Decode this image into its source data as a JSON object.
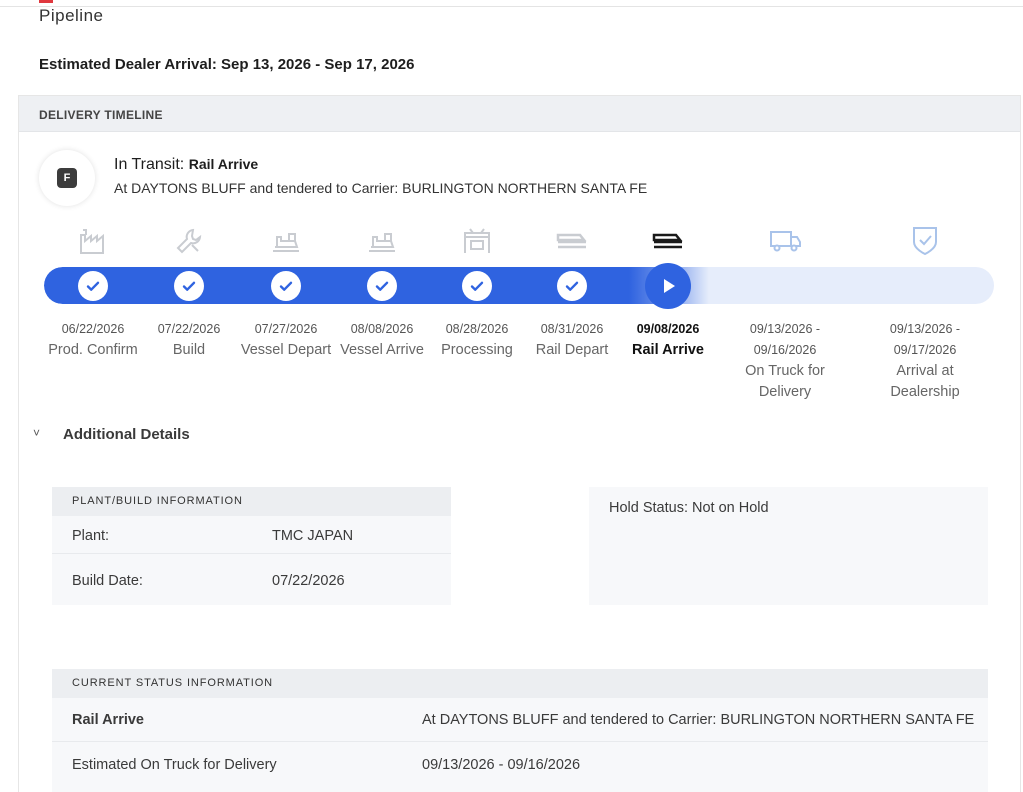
{
  "page": {
    "tab_label": "Pipeline",
    "estimated_arrival": "Estimated Dealer Arrival: Sep 13, 2026 - Sep 17, 2026"
  },
  "timeline": {
    "header": "DELIVERY TIMELINE",
    "badge_letter": "F",
    "status_prefix": "In Transit:",
    "status_stage": "Rail Arrive",
    "status_description": "At DAYTONS BLUFF and tendered to Carrier: BURLINGTON NORTHERN SANTA FE",
    "accent_color": "#2f63e0",
    "progress_fraction": 0.7,
    "steps": [
      {
        "date": "06/22/2026",
        "label": "Prod. Confirm",
        "state": "complete",
        "icon": "factory-icon"
      },
      {
        "date": "07/22/2026",
        "label": "Build",
        "state": "complete",
        "icon": "wrench-icon"
      },
      {
        "date": "07/27/2026",
        "label": "Vessel Depart",
        "state": "complete",
        "icon": "ship-icon"
      },
      {
        "date": "08/08/2026",
        "label": "Vessel Arrive",
        "state": "complete",
        "icon": "ship-icon"
      },
      {
        "date": "08/28/2026",
        "label": "Processing",
        "state": "complete",
        "icon": "processing-icon"
      },
      {
        "date": "08/31/2026",
        "label": "Rail Depart",
        "state": "complete",
        "icon": "train-icon"
      },
      {
        "date": "09/08/2026",
        "label": "Rail Arrive",
        "state": "current",
        "icon": "train-icon"
      },
      {
        "date": "09/13/2026 -",
        "date2": "09/16/2026",
        "label": "On Truck for Delivery",
        "state": "upcoming",
        "icon": "truck-icon"
      },
      {
        "date": "09/13/2026 -",
        "date2": "09/17/2026",
        "label": "Arrival at Dealership",
        "state": "upcoming",
        "icon": "shield-check-icon"
      }
    ]
  },
  "details": {
    "toggle_glyph": "˅",
    "title": "Additional Details",
    "plant_build": {
      "header": "PLANT/BUILD INFORMATION",
      "plant_label": "Plant:",
      "plant_value": "TMC JAPAN",
      "build_date_label": "Build Date:",
      "build_date_value": "07/22/2026"
    },
    "hold_status": "Hold Status: Not on Hold",
    "current_status": {
      "header": "CURRENT STATUS INFORMATION",
      "stage_label": "Rail Arrive",
      "stage_value": "At DAYTONS BLUFF and tendered to Carrier: BURLINGTON NORTHERN SANTA FE",
      "truck_label": "Estimated On Truck for Delivery",
      "truck_value": "09/13/2026 - 09/16/2026"
    }
  }
}
